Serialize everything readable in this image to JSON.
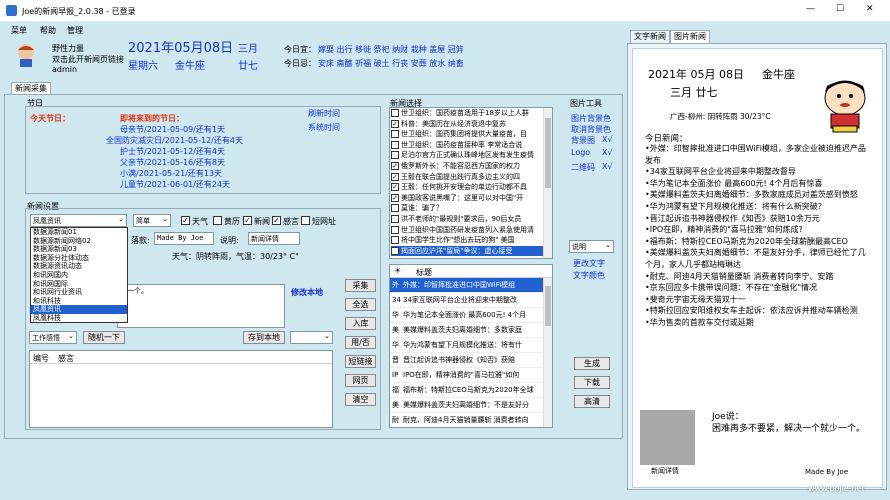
{
  "window": {
    "title": "Joe的新闻早报_2.0.38 - 已登录",
    "minimize": "—",
    "maximize": "☐",
    "close": "✕"
  },
  "menu": [
    "菜单",
    "帮助",
    "管理"
  ],
  "user": {
    "line1": "野性力量",
    "line2": "双击此开新闻页链接",
    "line3": "admin"
  },
  "date": {
    "main": "2021年05月08日",
    "weekday": "星期六",
    "star": "金牛座",
    "lunar_month": "三月",
    "lunar_day": "廿七",
    "good_label": "今日宜：",
    "good": "嫁娶 出行 移徙 祭祀 纳财 栽种 盖屋 冠笄",
    "bad_label": "今日忌：",
    "bad": "安床 斋醮 祈福 破土 行丧 安葬 放水 纳畜"
  },
  "left_tab": "新闻采集",
  "festival": {
    "label": "节日",
    "today_label": "今天节日：",
    "upcoming_label": "即将来到的节日：",
    "items": [
      "母亲节/2021-05-09/还有1天",
      "全国防灾减灾日/2021-05-12/还有4天",
      "护士节/2021-05-12/还有4天",
      "父亲节/2021-05-16/还有8天",
      "小满/2021-05-21/还有13天",
      "儿童节/2021-06-01/还有24天"
    ],
    "btn_refresh_time": "刷新时间",
    "btn_system_time": "系统时间"
  },
  "settings": {
    "label": "新闻设置",
    "source": "凤凰资讯",
    "mode": "简单",
    "checks": [
      {
        "label": "天气",
        "checked": true
      },
      {
        "label": "黄历",
        "checked": false
      },
      {
        "label": "新闻",
        "checked": true
      },
      {
        "label": "感言",
        "checked": true
      },
      {
        "label": "短网址",
        "checked": false
      }
    ],
    "dropdown_options": [
      "数据源新闻01",
      "数据源新闻网络02",
      "数据源新闻03",
      "数据源分社体动态",
      "数据源资讯动态",
      "和讯网国内",
      "和讯网国际",
      "和讯网行业资讯",
      "和讯科技",
      "凤凰资讯",
      "凤凰科技"
    ],
    "dropdown_selected": 9,
    "footer_label": "落款:",
    "footer_value": "Made By Joe",
    "desc_label": "说明:",
    "desc_value": "新闻详情",
    "weather_text": "天气：阴转阵雨，气温：30/23° C\"",
    "content_preview": "少一个。",
    "modify_link": "修改本地",
    "category": "工作感悟",
    "btn_next": "随机一下",
    "btn_save_local": "存到本地",
    "table_col1": "编号",
    "table_col2": "感言"
  },
  "middle_buttons": [
    "采集",
    "全选",
    "入库",
    "用/否",
    "短链接",
    "网页",
    "清空"
  ],
  "news_select": {
    "label": "新闻选择",
    "items": [
      {
        "text": "世卫组织：国药疫苗适用于18岁以上人群",
        "checked": false
      },
      {
        "text": "科普：美国历在从经济衰退中复苏",
        "checked": true
      },
      {
        "text": "世卫组织：国药集团将提供大量疫苗，目",
        "checked": false
      },
      {
        "text": "世卫组织：国药疫苗接种率 李常适合说",
        "checked": false
      },
      {
        "text": "尼泊尔官方正式确认珠峰地区发有发生疫情",
        "checked": false
      },
      {
        "text": "俄罗斯外长：不能容忍西方国家的权力",
        "checked": true
      },
      {
        "text": "王毅在联合国提出践行真多边主义的四",
        "checked": true
      },
      {
        "text": "王毅：任何挑开安理会的单边行动都不具",
        "checked": true
      },
      {
        "text": "美国政客说黑嘴了：这里可以对中国\"开",
        "checked": true
      },
      {
        "text": "莫谁：骗了？",
        "checked": false
      },
      {
        "text": "洪不老师的\"最规则\"要求后，90后女员",
        "checked": false
      },
      {
        "text": "世卫组织中国国药研发疫苗列入紧急使用清",
        "checked": false
      },
      {
        "text": "将中国学生比作\"想出去玩的狗\" 美国",
        "checked": false
      },
      {
        "text": "揭面回应沪洋\"留局\"争议：虚心接受",
        "checked": false
      }
    ],
    "selected_index": 13
  },
  "titles_list": {
    "header_star": "☀",
    "header": "标题",
    "items": [
      {
        "flag": "外",
        "text": "外媒：印智摔批准进口中国WiFi模组"
      },
      {
        "flag": "34",
        "text": "34家互联网平台企业将迎来中期整改"
      },
      {
        "flag": "华",
        "text": "华为笔记本全面涨价 最高600元! 4个月"
      },
      {
        "flag": "美",
        "text": "美媒爆料盖茨夫妇离婚细节：多数家庭"
      },
      {
        "flag": "华",
        "text": "华为鸿蒙有望下月规模化推送：将有什"
      },
      {
        "flag": "晋",
        "text": "晋江起诉追书神器侵权《知否》获赔"
      },
      {
        "flag": "IP",
        "text": "IPO在即，精神消费的\"喜马拉雅\"如何"
      },
      {
        "flag": "福",
        "text": "福布斯：特斯拉CEO马斯克为2020年全球"
      },
      {
        "flag": "美",
        "text": "美媒爆料盖茨夫妇离婚细节：不是友好分"
      },
      {
        "flag": "耐",
        "text": "耐克、阿迪4月天猫销量腰斩 消费者转向"
      }
    ],
    "selected_index": 0
  },
  "image_tools": {
    "label": "图片工具",
    "links": [
      "图片背景色",
      "取消背景色",
      "背景图",
      "Logo",
      "二维码"
    ],
    "marks": [
      "X√",
      "X√",
      "X√"
    ],
    "desc_select": "说明",
    "modify_text": "更改文字",
    "text_color": "文字颜色",
    "btn_generate": "生成",
    "btn_download": "下载",
    "btn_hd": "高清"
  },
  "right": {
    "tab1": "文字新闻",
    "tab2": "图片新闻",
    "date": "2021年 05月 08日",
    "star": "金牛座",
    "lunar": "三月 廿七",
    "weather": "广西-柳州: 阴转阵雨 30/23°C",
    "news_header": "今日新闻：",
    "news": [
      "•外媒：印智摔批准进口中国WiFi模组，多家企业被迫推迟产品发布",
      "•34家互联网平台企业将迎来中期整改督导",
      "•华为笔记本全面涨价 最高600元! 4个月后有惊喜",
      "•美媒爆料盖茨夫妇离婚细节：多数家庭成员对盖茨感到愤怒",
      "•华为鸿蒙有望下月规模化推送：将有什么新突破?",
      "•晋江起诉追书神器侵权作《知否》获赔10余万元",
      "•IPO在即，精神消费的\"喜马拉雅\"如何炼成?",
      "•福布斯：特斯拉CEO马斯克为2020年全球薪酬最高CEO",
      "•美媒爆料盖茨夫妇离婚细节：不是友好分手，律师已经忙了几个月，家人几乎都站梅琳达",
      "•耐克、阿迪4月天猫销量腰斩 消费者转向李宁、安踏",
      "•京东回应多卡携带误问题：不存在\"金融化\"情况",
      "•斐奇元宇宙无缘天猫双十一",
      "•特斯拉回应安阳维权女车主起诉：依法应诉并推动车辆检测",
      "•华为售卖的首款车交付或延期"
    ],
    "joe_says": "Joe说：",
    "quote": "困难再多不要紧，解决一个就少一个。",
    "qr_caption": "新闻详情",
    "made_by": "Made By Joe"
  },
  "watermark": "www.pojie.net"
}
